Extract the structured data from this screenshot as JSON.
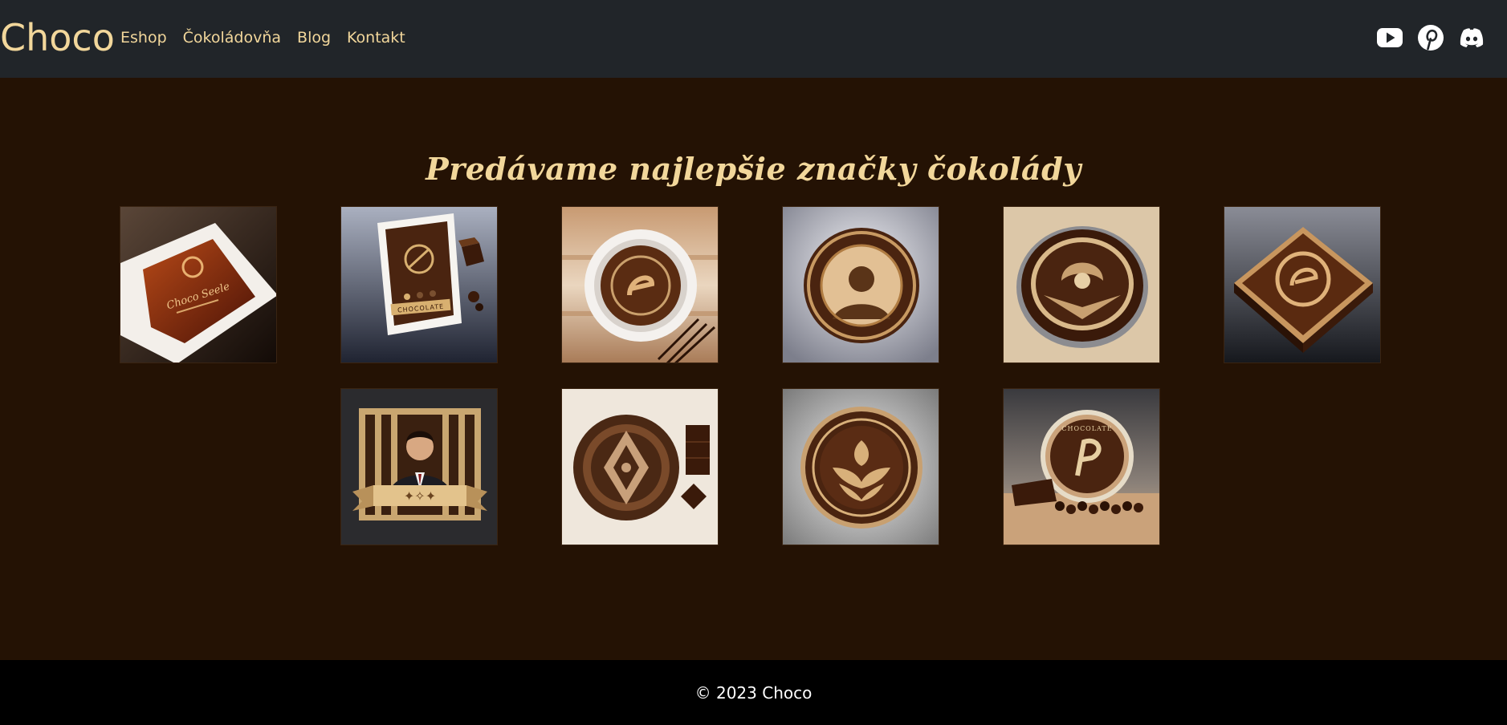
{
  "header": {
    "brand": "Choco",
    "nav": [
      "Eshop",
      "Čokoládovňa",
      "Blog",
      "Kontakt"
    ],
    "social_icons": [
      "youtube-icon",
      "pinterest-icon",
      "discord-icon"
    ]
  },
  "main": {
    "title": "Predávame najlepšie značky čokolády",
    "brands": [
      {
        "icon": "chocolate-box-logo",
        "text": "Choco Seele"
      },
      {
        "icon": "chocolate-bar-package-logo",
        "text": "CHOCOLATE"
      },
      {
        "icon": "chocolate-plate-e-logo",
        "text": ""
      },
      {
        "icon": "chocolatier-portrait-logo",
        "text": ""
      },
      {
        "icon": "chocolate-swirl-emblem",
        "text": ""
      },
      {
        "icon": "chocolate-square-e-logo",
        "text": ""
      },
      {
        "icon": "gentleman-banner-logo",
        "text": ""
      },
      {
        "icon": "chocolate-compass-logo",
        "text": ""
      },
      {
        "icon": "cocoa-leaf-emblem",
        "text": ""
      },
      {
        "icon": "chocolate-coin-logo",
        "text": "CHOCOLATE"
      }
    ]
  },
  "footer": {
    "copyright": "© 2023 Choco"
  },
  "colors": {
    "accent": "#f2d79b",
    "navbar": "#212529",
    "page": "#241204",
    "footer": "#000000"
  }
}
